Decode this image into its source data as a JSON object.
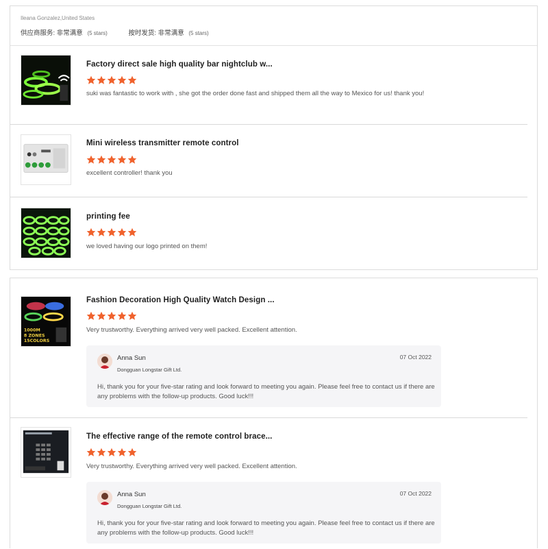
{
  "reviewer": {
    "name": "Ileana Gonzalez,United States",
    "ratings": [
      {
        "label": "供应商服务:",
        "value": "非常满意",
        "detail": "(5 stars)"
      },
      {
        "label": "按时发货:",
        "value": "非常满意",
        "detail": "(5 stars)"
      }
    ]
  },
  "colors": {
    "star": "#f0622d",
    "border": "#dcdcdc",
    "reply_bg": "#f5f5f7"
  },
  "reviews_top": [
    {
      "title": "Factory direct sale high quality bar nightclub w...",
      "rating": 5,
      "comment": "suki was fantastic to work with , she got the order done fast and shipped them all the way to Mexico for us! thank you!",
      "thumb_icon": "glowing-wristbands-image"
    },
    {
      "title": "Mini wireless transmitter remote control",
      "rating": 5,
      "comment": "excellent controller! thank you",
      "thumb_icon": "remote-control-image"
    },
    {
      "title": "printing fee",
      "rating": 5,
      "comment": "we loved having our logo printed on them!",
      "thumb_icon": "printed-wristbands-image"
    }
  ],
  "reviews_bottom": [
    {
      "title": "Fashion Decoration High Quality Watch Design ...",
      "rating": 5,
      "comment": "Very trustworthy. Everything arrived very well packed. Excellent attention.",
      "thumb_icon": "led-bracelet-image",
      "thumb_text": [
        "1000M",
        "8 ZONES",
        "15COLORS"
      ],
      "reply": {
        "name": "Anna Sun",
        "company": "Dongguan Longstar Gift Ltd.",
        "date": "07 Oct 2022",
        "text": "Hi, thank you for your five-star rating and look forward to meeting you again. Please feel free to contact us if there are any problems with the follow-up products. Good luck!!!"
      }
    },
    {
      "title": "The effective range of the remote control brace...",
      "rating": 5,
      "comment": "Very trustworthy. Everything arrived very well packed. Excellent attention.",
      "thumb_icon": "remote-control-panel-image",
      "reply": {
        "name": "Anna Sun",
        "company": "Dongguan Longstar Gift Ltd.",
        "date": "07 Oct 2022",
        "text": "Hi, thank you for your five-star rating and look forward to meeting you again. Please feel free to contact us if there are any problems with the follow-up products. Good luck!!!"
      }
    }
  ]
}
